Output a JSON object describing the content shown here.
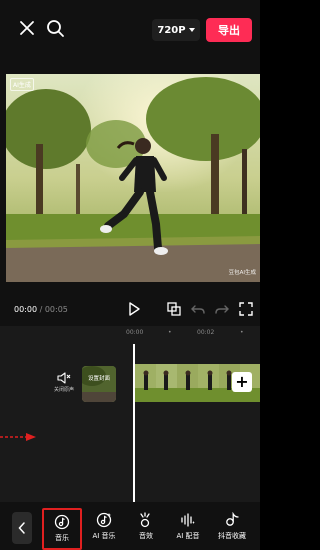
{
  "topbar": {
    "close_icon": "close-icon",
    "search_icon": "search-icon",
    "resolution": "720P",
    "export_label": "导出"
  },
  "preview": {
    "ai_badge": "AI生成",
    "watermark": "豆包AI生成"
  },
  "playback": {
    "current_time": "00:00",
    "separator": " / ",
    "total_time": "00:05",
    "icons": [
      "play-icon",
      "crop-icon",
      "undo-icon",
      "redo-icon",
      "fullscreen-icon"
    ]
  },
  "timeline": {
    "ruler": [
      "00:00",
      "•",
      "00:02",
      "•"
    ],
    "mute_label": "关闭原声",
    "cover_label": "设置封面",
    "add_icon": "+"
  },
  "toolbar": {
    "items": [
      {
        "label": "音乐",
        "icon": "music-icon",
        "selected": true
      },
      {
        "label": "AI 音乐",
        "icon": "ai-music-icon",
        "selected": false
      },
      {
        "label": "音效",
        "icon": "sound-effect-icon",
        "selected": false
      },
      {
        "label": "AI 配音",
        "icon": "ai-dubbing-icon",
        "selected": false
      },
      {
        "label": "抖音收藏",
        "icon": "douyin-favorites-icon",
        "selected": false
      }
    ]
  },
  "colors": {
    "accent": "#fe2c55",
    "selection": "#e02020",
    "pointer": "#e02020"
  }
}
